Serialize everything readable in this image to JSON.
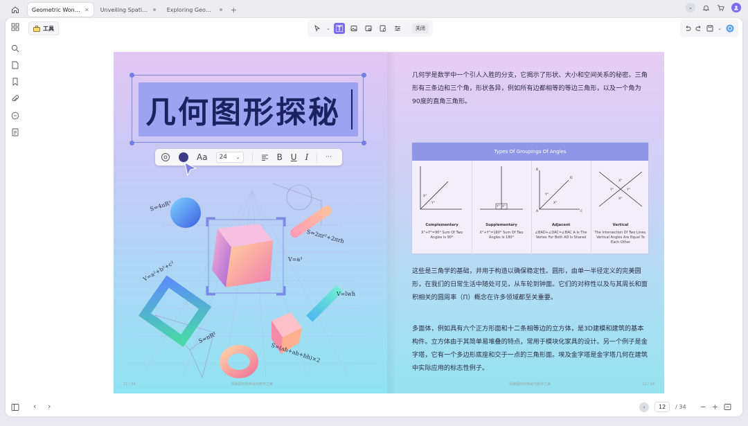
{
  "tabs": [
    {
      "label": "Geometric Wonde...",
      "active": true
    },
    {
      "label": "Unveiling Spatial My...",
      "active": false
    },
    {
      "label": "Exploring Geometric...",
      "active": false
    }
  ],
  "toolbar": {
    "tools_label": "工具",
    "close_label": "关闭"
  },
  "left_page": {
    "title": "几何图形探秘",
    "font_size": "24",
    "font_label": "Aa",
    "bold": "B",
    "underline": "U",
    "italic": "I",
    "more": "···",
    "formulas": {
      "sphere": "S=4πR²",
      "cylinder": "S=2πr²+2πrh",
      "cube": "V=a³",
      "prism": "V=lwh",
      "frame": "V=a²+b²+c²",
      "cone": "S=πR²",
      "pyramid": "S=(ah+ah+bh)×2"
    },
    "page_number": "11 / 34",
    "caption": "探索图形的奥秘与数学之美"
  },
  "right_page": {
    "para1": "几何学是数学中一个引人入胜的分支，它揭示了形状、大小和空间关系的秘密。三角形有三条边和三个角，形状各异，例如所有边都相等的等边三角形，以及一个角为90度的直角三角形。",
    "table_title": "Types Of Groupings Of Angles",
    "angles": [
      {
        "name": "Complementary",
        "desc": "X°+Y°=90° Sum Of Two Angles Is 90°"
      },
      {
        "name": "Supplementary",
        "desc": "X°+Y°=180° Sum Of Two Angles Is 180°"
      },
      {
        "name": "Adjacent",
        "desc": "∠BAD+∠DAC=∠BAC A Is The Vertex For Both AD Is Shared"
      },
      {
        "name": "Vertical",
        "desc": "The Intersection Of Two Lines. Vertical Angles Are Equal To Each Other"
      }
    ],
    "para2": "这些是三角学的基础，并用于构造以确保稳定性。圆形，由单一半径定义的完美圆形，在我们的日常生活中随处可见，从车轮到钟面。它们的对称性以及与其周长和面积相关的圆周率（Π）概念在许多领域都至关重要。",
    "para3": "多面体，例如具有六个正方形面和十二条相等边的立方体，是3D建模和建筑的基本构件。立方体由于其简单易堆叠的特点，常用于模块化家具的设计。另一个例子是金字塔，它有一个多边形底座和交于一点的三角形面。埃及金字塔是金字塔几何在建筑中实际应用的标志性例子。",
    "page_number": "12 / 34",
    "caption": "探索图形的奥秘与数学之美"
  },
  "bottom": {
    "current_page": "12",
    "total_pages": "/ 34",
    "minus": "−",
    "plus": "+"
  }
}
